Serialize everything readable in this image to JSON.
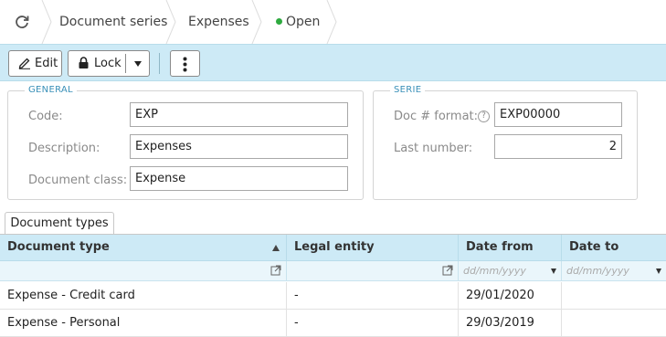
{
  "breadcrumb": {
    "items": [
      "Document series",
      "Expenses"
    ],
    "status": "Open",
    "status_color": "#2eaa3f"
  },
  "toolbar": {
    "edit_label": "Edit",
    "lock_label": "Lock"
  },
  "general": {
    "legend": "GENERAL",
    "code_label": "Code:",
    "code_value": "EXP",
    "description_label": "Description:",
    "description_value": "Expenses",
    "class_label": "Document class:",
    "class_value": "Expense"
  },
  "serie": {
    "legend": "SERIE",
    "format_label": "Doc # format:",
    "format_value": "EXP00000",
    "last_label": "Last number:",
    "last_value": "2"
  },
  "tabs": [
    "Document types"
  ],
  "grid": {
    "columns": [
      "Document type",
      "Legal entity",
      "Date from",
      "Date to"
    ],
    "date_placeholder": "dd/mm/yyyy",
    "rows": [
      [
        "Expense - Credit card",
        "-",
        "29/01/2020",
        ""
      ],
      [
        "Expense - Personal",
        "-",
        "29/03/2019",
        ""
      ]
    ]
  },
  "icons": [
    "refresh-icon",
    "pencil-icon",
    "lock-icon",
    "caret-down-icon",
    "more-vertical-icon",
    "help-icon",
    "sort-asc-icon",
    "open-external-icon"
  ]
}
